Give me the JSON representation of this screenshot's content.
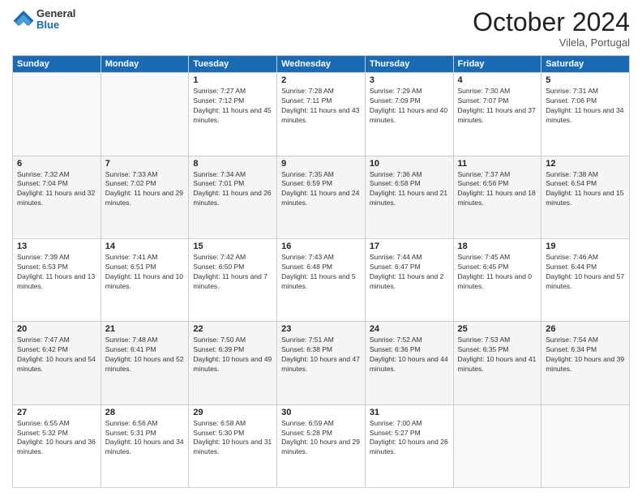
{
  "header": {
    "logo_general": "General",
    "logo_blue": "Blue",
    "month_title": "October 2024",
    "subtitle": "Vilela, Portugal"
  },
  "days_of_week": [
    "Sunday",
    "Monday",
    "Tuesday",
    "Wednesday",
    "Thursday",
    "Friday",
    "Saturday"
  ],
  "weeks": [
    [
      {
        "day": "",
        "sunrise": "",
        "sunset": "",
        "daylight": "",
        "empty": true
      },
      {
        "day": "",
        "sunrise": "",
        "sunset": "",
        "daylight": "",
        "empty": true
      },
      {
        "day": "1",
        "sunrise": "Sunrise: 7:27 AM",
        "sunset": "Sunset: 7:12 PM",
        "daylight": "Daylight: 11 hours and 45 minutes.",
        "empty": false
      },
      {
        "day": "2",
        "sunrise": "Sunrise: 7:28 AM",
        "sunset": "Sunset: 7:11 PM",
        "daylight": "Daylight: 11 hours and 43 minutes.",
        "empty": false
      },
      {
        "day": "3",
        "sunrise": "Sunrise: 7:29 AM",
        "sunset": "Sunset: 7:09 PM",
        "daylight": "Daylight: 11 hours and 40 minutes.",
        "empty": false
      },
      {
        "day": "4",
        "sunrise": "Sunrise: 7:30 AM",
        "sunset": "Sunset: 7:07 PM",
        "daylight": "Daylight: 11 hours and 37 minutes.",
        "empty": false
      },
      {
        "day": "5",
        "sunrise": "Sunrise: 7:31 AM",
        "sunset": "Sunset: 7:06 PM",
        "daylight": "Daylight: 11 hours and 34 minutes.",
        "empty": false
      }
    ],
    [
      {
        "day": "6",
        "sunrise": "Sunrise: 7:32 AM",
        "sunset": "Sunset: 7:04 PM",
        "daylight": "Daylight: 11 hours and 32 minutes.",
        "empty": false
      },
      {
        "day": "7",
        "sunrise": "Sunrise: 7:33 AM",
        "sunset": "Sunset: 7:02 PM",
        "daylight": "Daylight: 11 hours and 29 minutes.",
        "empty": false
      },
      {
        "day": "8",
        "sunrise": "Sunrise: 7:34 AM",
        "sunset": "Sunset: 7:01 PM",
        "daylight": "Daylight: 11 hours and 26 minutes.",
        "empty": false
      },
      {
        "day": "9",
        "sunrise": "Sunrise: 7:35 AM",
        "sunset": "Sunset: 6:59 PM",
        "daylight": "Daylight: 11 hours and 24 minutes.",
        "empty": false
      },
      {
        "day": "10",
        "sunrise": "Sunrise: 7:36 AM",
        "sunset": "Sunset: 6:58 PM",
        "daylight": "Daylight: 11 hours and 21 minutes.",
        "empty": false
      },
      {
        "day": "11",
        "sunrise": "Sunrise: 7:37 AM",
        "sunset": "Sunset: 6:56 PM",
        "daylight": "Daylight: 11 hours and 18 minutes.",
        "empty": false
      },
      {
        "day": "12",
        "sunrise": "Sunrise: 7:38 AM",
        "sunset": "Sunset: 6:54 PM",
        "daylight": "Daylight: 11 hours and 15 minutes.",
        "empty": false
      }
    ],
    [
      {
        "day": "13",
        "sunrise": "Sunrise: 7:39 AM",
        "sunset": "Sunset: 6:53 PM",
        "daylight": "Daylight: 11 hours and 13 minutes.",
        "empty": false
      },
      {
        "day": "14",
        "sunrise": "Sunrise: 7:41 AM",
        "sunset": "Sunset: 6:51 PM",
        "daylight": "Daylight: 11 hours and 10 minutes.",
        "empty": false
      },
      {
        "day": "15",
        "sunrise": "Sunrise: 7:42 AM",
        "sunset": "Sunset: 6:50 PM",
        "daylight": "Daylight: 11 hours and 7 minutes.",
        "empty": false
      },
      {
        "day": "16",
        "sunrise": "Sunrise: 7:43 AM",
        "sunset": "Sunset: 6:48 PM",
        "daylight": "Daylight: 11 hours and 5 minutes.",
        "empty": false
      },
      {
        "day": "17",
        "sunrise": "Sunrise: 7:44 AM",
        "sunset": "Sunset: 6:47 PM",
        "daylight": "Daylight: 11 hours and 2 minutes.",
        "empty": false
      },
      {
        "day": "18",
        "sunrise": "Sunrise: 7:45 AM",
        "sunset": "Sunset: 6:45 PM",
        "daylight": "Daylight: 11 hours and 0 minutes.",
        "empty": false
      },
      {
        "day": "19",
        "sunrise": "Sunrise: 7:46 AM",
        "sunset": "Sunset: 6:44 PM",
        "daylight": "Daylight: 10 hours and 57 minutes.",
        "empty": false
      }
    ],
    [
      {
        "day": "20",
        "sunrise": "Sunrise: 7:47 AM",
        "sunset": "Sunset: 6:42 PM",
        "daylight": "Daylight: 10 hours and 54 minutes.",
        "empty": false
      },
      {
        "day": "21",
        "sunrise": "Sunrise: 7:48 AM",
        "sunset": "Sunset: 6:41 PM",
        "daylight": "Daylight: 10 hours and 52 minutes.",
        "empty": false
      },
      {
        "day": "22",
        "sunrise": "Sunrise: 7:50 AM",
        "sunset": "Sunset: 6:39 PM",
        "daylight": "Daylight: 10 hours and 49 minutes.",
        "empty": false
      },
      {
        "day": "23",
        "sunrise": "Sunrise: 7:51 AM",
        "sunset": "Sunset: 6:38 PM",
        "daylight": "Daylight: 10 hours and 47 minutes.",
        "empty": false
      },
      {
        "day": "24",
        "sunrise": "Sunrise: 7:52 AM",
        "sunset": "Sunset: 6:36 PM",
        "daylight": "Daylight: 10 hours and 44 minutes.",
        "empty": false
      },
      {
        "day": "25",
        "sunrise": "Sunrise: 7:53 AM",
        "sunset": "Sunset: 6:35 PM",
        "daylight": "Daylight: 10 hours and 41 minutes.",
        "empty": false
      },
      {
        "day": "26",
        "sunrise": "Sunrise: 7:54 AM",
        "sunset": "Sunset: 6:34 PM",
        "daylight": "Daylight: 10 hours and 39 minutes.",
        "empty": false
      }
    ],
    [
      {
        "day": "27",
        "sunrise": "Sunrise: 6:55 AM",
        "sunset": "Sunset: 5:32 PM",
        "daylight": "Daylight: 10 hours and 36 minutes.",
        "empty": false
      },
      {
        "day": "28",
        "sunrise": "Sunrise: 6:56 AM",
        "sunset": "Sunset: 5:31 PM",
        "daylight": "Daylight: 10 hours and 34 minutes.",
        "empty": false
      },
      {
        "day": "29",
        "sunrise": "Sunrise: 6:58 AM",
        "sunset": "Sunset: 5:30 PM",
        "daylight": "Daylight: 10 hours and 31 minutes.",
        "empty": false
      },
      {
        "day": "30",
        "sunrise": "Sunrise: 6:59 AM",
        "sunset": "Sunset: 5:28 PM",
        "daylight": "Daylight: 10 hours and 29 minutes.",
        "empty": false
      },
      {
        "day": "31",
        "sunrise": "Sunrise: 7:00 AM",
        "sunset": "Sunset: 5:27 PM",
        "daylight": "Daylight: 10 hours and 26 minutes.",
        "empty": false
      },
      {
        "day": "",
        "sunrise": "",
        "sunset": "",
        "daylight": "",
        "empty": true
      },
      {
        "day": "",
        "sunrise": "",
        "sunset": "",
        "daylight": "",
        "empty": true
      }
    ]
  ]
}
